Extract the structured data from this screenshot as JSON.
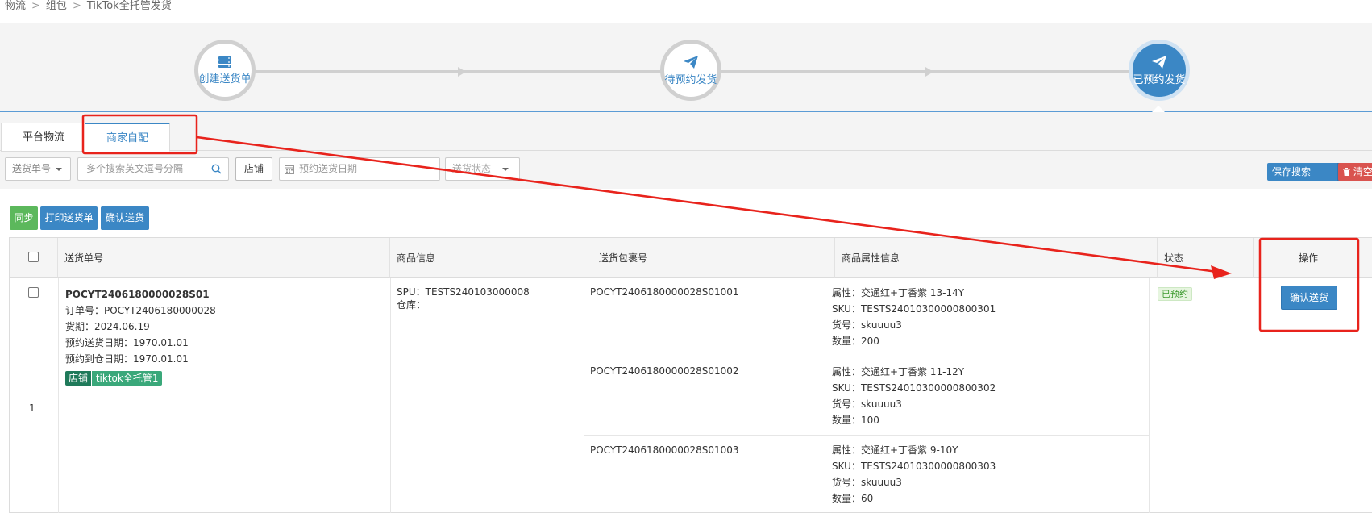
{
  "breadcrumb": [
    "物流",
    "组包",
    "TikTok全托管发货"
  ],
  "steps": [
    {
      "label": "创建送货单",
      "icon": "server-icon"
    },
    {
      "label": "待预约发货",
      "icon": "paper-plane-icon"
    },
    {
      "label": "已预约发货",
      "icon": "paper-plane-icon"
    }
  ],
  "tabs": [
    {
      "label": "平台物流"
    },
    {
      "label": "商家自配"
    }
  ],
  "filters": {
    "delivery_no_select": "送货单号",
    "search_placeholder": "多个搜索英文逗号分隔",
    "shop_button": "店铺",
    "date_placeholder": "预约送货日期",
    "status_select": "送货状态",
    "save_search": "保存搜索",
    "clear": "清空"
  },
  "actions": {
    "sync": "同步",
    "print": "打印送货单",
    "confirm": "确认送货"
  },
  "table": {
    "headers": [
      "送货单号",
      "商品信息",
      "送货包裹号",
      "商品属性信息",
      "状态",
      "操作"
    ],
    "row": {
      "index": "1",
      "delivery_no": "POCYT2406180000028S01",
      "order_line": "订单号：POCYT2406180000028",
      "period_line": "货期：2024.06.19",
      "send_date_line": "预约送货日期：1970.01.01",
      "arrive_date_line": "预约到仓日期：1970.01.01",
      "shop_tag": "店铺",
      "shop_name": "tiktok全托管1",
      "spu_line": "SPU：TESTS240103000008",
      "warehouse_line": "仓库：",
      "status": "已预约",
      "action": "确认送货",
      "packages": [
        {
          "no": "POCYT2406180000028S01001",
          "attr": "属性：交通红+丁香紫 13-14Y",
          "sku": "SKU：TESTS24010300000800301",
          "code": "货号：skuuuu3",
          "qty": "数量：200"
        },
        {
          "no": "POCYT2406180000028S01002",
          "attr": "属性：交通红+丁香紫 11-12Y",
          "sku": "SKU：TESTS24010300000800302",
          "code": "货号：skuuuu3",
          "qty": "数量：100"
        },
        {
          "no": "POCYT2406180000028S01003",
          "attr": "属性：交通红+丁香紫 9-10Y",
          "sku": "SKU：TESTS24010300000800303",
          "code": "货号：skuuuu3",
          "qty": "数量：60"
        }
      ]
    }
  },
  "colors": {
    "primary": "#3b87c5",
    "success": "#5cb85c",
    "danger": "#d9534f",
    "annotation": "#e8231c"
  }
}
